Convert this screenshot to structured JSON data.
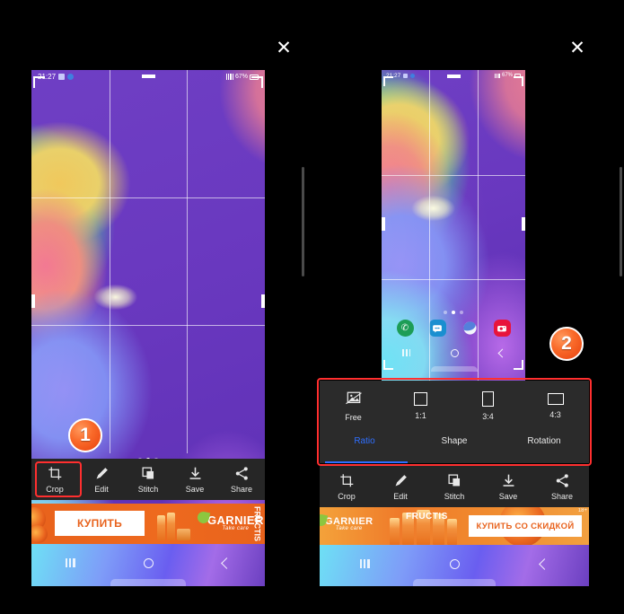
{
  "meta": {
    "background": "#000000",
    "accent_red": "#ff2f2f",
    "accent_blue": "#2f6fff"
  },
  "panels": {
    "left": {
      "close_label": "✕",
      "badge": "1",
      "statusbar": {
        "time": "21:27",
        "battery": "67%"
      },
      "toolbar": {
        "items": [
          {
            "label": "Crop",
            "icon": "crop-icon",
            "highlighted": true
          },
          {
            "label": "Edit",
            "icon": "pencil-icon",
            "highlighted": false
          },
          {
            "label": "Stitch",
            "icon": "stitch-icon",
            "highlighted": false
          },
          {
            "label": "Save",
            "icon": "download-icon",
            "highlighted": false
          },
          {
            "label": "Share",
            "icon": "share-icon",
            "highlighted": false
          }
        ]
      },
      "ad": {
        "cta": "КУПИТЬ",
        "brand": "GARNIER",
        "brand_sub": "Take care",
        "product": "FRUCTIS"
      }
    },
    "right": {
      "close_label": "✕",
      "badge": "2",
      "statusbar": {
        "time": "21:27",
        "battery": "67%"
      },
      "crop_panel": {
        "ratios": [
          {
            "label": "Free",
            "icon": "free-crop-icon"
          },
          {
            "label": "1:1",
            "icon": "square-icon"
          },
          {
            "label": "3:4",
            "icon": "portrait-icon"
          },
          {
            "label": "4:3",
            "icon": "landscape-icon"
          }
        ],
        "tabs": [
          {
            "label": "Ratio",
            "active": true
          },
          {
            "label": "Shape",
            "active": false
          },
          {
            "label": "Rotation",
            "active": false
          }
        ]
      },
      "toolbar": {
        "items": [
          {
            "label": "Crop",
            "icon": "crop-icon",
            "highlighted": false
          },
          {
            "label": "Edit",
            "icon": "pencil-icon",
            "highlighted": false
          },
          {
            "label": "Stitch",
            "icon": "stitch-icon",
            "highlighted": false
          },
          {
            "label": "Save",
            "icon": "download-icon",
            "highlighted": false
          },
          {
            "label": "Share",
            "icon": "share-icon",
            "highlighted": false
          }
        ]
      },
      "ad": {
        "cta": "КУПИТЬ СО СКИДКОЙ",
        "brand": "GARNIER",
        "brand_sub": "Take care",
        "product": "FRUCTIS",
        "age": "18+"
      }
    }
  },
  "phone": {
    "dock_apps": [
      {
        "name": "phone-app-icon",
        "glyph": "✆"
      },
      {
        "name": "messages-app-icon",
        "glyph": "•••"
      },
      {
        "name": "browser-app-icon",
        "glyph": ""
      },
      {
        "name": "camera-app-icon",
        "glyph": "◉"
      }
    ],
    "nav": [
      {
        "name": "recents-button"
      },
      {
        "name": "home-button"
      },
      {
        "name": "back-button"
      }
    ]
  }
}
